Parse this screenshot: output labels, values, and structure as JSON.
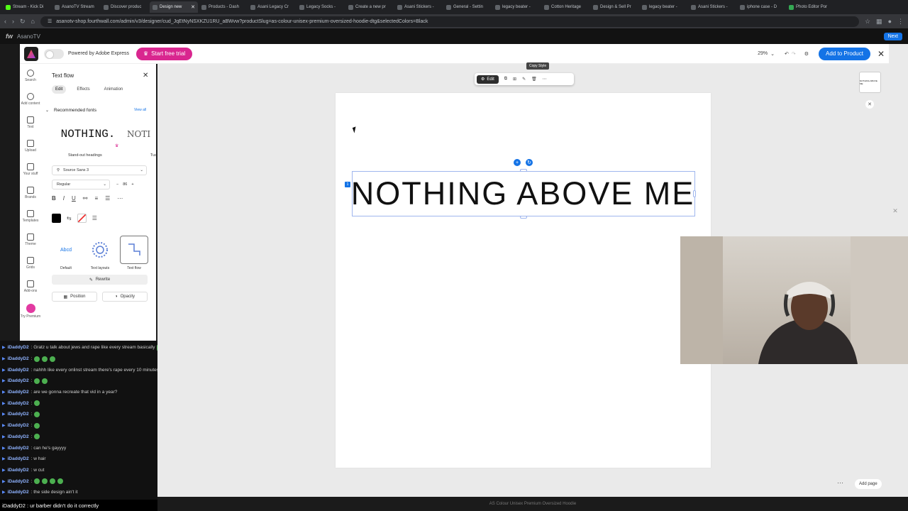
{
  "browser": {
    "tabs": [
      {
        "label": "Stream - Kick Di",
        "fav": "k"
      },
      {
        "label": "AsanoTV Stream",
        "fav": ""
      },
      {
        "label": "Discover produc",
        "fav": ""
      },
      {
        "label": "Design new",
        "fav": "",
        "active": true
      },
      {
        "label": "Products - Dash",
        "fav": ""
      },
      {
        "label": "Asani Legacy Cr",
        "fav": ""
      },
      {
        "label": "Legacy Socks -",
        "fav": ""
      },
      {
        "label": "Create a new pr",
        "fav": ""
      },
      {
        "label": "Asani Stickers -",
        "fav": ""
      },
      {
        "label": "General - Settin",
        "fav": ""
      },
      {
        "label": "legacy beater -",
        "fav": ""
      },
      {
        "label": "Cotton Heritage",
        "fav": ""
      },
      {
        "label": "Design & Sell Pr",
        "fav": ""
      },
      {
        "label": "legacy beater -",
        "fav": ""
      },
      {
        "label": "Asani Stickers -",
        "fav": ""
      },
      {
        "label": "iphone case - D",
        "fav": ""
      },
      {
        "label": "Photo Editor Por",
        "fav": "g"
      }
    ],
    "url": "asanotv-shop.fourthwall.com/admin/v3/designer/cud_JqEtNyNSXKZU1RU_aBWvw?productSlug=as-colour-unisex-premium-oversized-hoodie-dtg&selectedColors=Black",
    "bookmark_label": "AsanoTV",
    "next_label": "Next"
  },
  "appbar": {
    "powered_by": "Powered by Adobe Express",
    "trial_label": "Start free trial",
    "zoom": "29%",
    "add_product_label": "Add to Product"
  },
  "rail": [
    {
      "label": "Search"
    },
    {
      "label": "Add content"
    },
    {
      "label": "Text"
    },
    {
      "label": "Upload"
    },
    {
      "label": "Your stuff"
    },
    {
      "label": "Brands"
    },
    {
      "label": "Templates"
    },
    {
      "label": "Theme"
    },
    {
      "label": "Grids"
    },
    {
      "label": "Add-ons"
    },
    {
      "label": "Try Premium"
    }
  ],
  "panel": {
    "title": "Text flow",
    "tabs": [
      "Edit",
      "Effects",
      "Animation"
    ],
    "recommended_label": "Recommended fonts",
    "view_all": "View all",
    "font_preview_1": "NOTHING.",
    "font_preview_2": "NOTI",
    "font_caption_1": "Stand-out headings",
    "font_caption_2": "Tus",
    "font_family": "Source Sans 3",
    "font_weight": "Regular",
    "font_size": "86",
    "presets": [
      {
        "preview": "Abcd",
        "caption": "Default"
      },
      {
        "preview": "",
        "caption": "Text layouts"
      },
      {
        "preview": "Abc defg",
        "caption": "Text flow"
      }
    ],
    "rewrite_label": "Rewrite",
    "position_label": "Position",
    "opacity_label": "Opacity"
  },
  "canvas": {
    "text": "NOTHING ABOVE ME",
    "layer_number": "1",
    "edit_label": "Edit",
    "copy_style_tooltip": "Copy Style",
    "thumb_text": "NOTHING ABOVE ME",
    "add_page_label": "Add page",
    "footer_label": "AS Colour Unisex Premium Oversized Hoodie"
  },
  "chat": [
    {
      "user": "iDaddyD2",
      "text": ": Gratz u talk about jews and rape like every stream basically",
      "emotes": 1
    },
    {
      "user": "iDaddyD2",
      "text": ":",
      "emotes": 3
    },
    {
      "user": "iDaddyD2",
      "text": ": nahhh like every onlinst stream there's rape every 10 minutes",
      "emotes": 0
    },
    {
      "user": "iDaddyD2",
      "text": ":",
      "emotes": 2
    },
    {
      "user": "iDaddyD2",
      "text": ": are we gonna recreate that vid in a year?",
      "emotes": 0
    },
    {
      "user": "iDaddyD2",
      "text": ":",
      "emotes": 1
    },
    {
      "user": "iDaddyD2",
      "text": ":",
      "emotes": 1
    },
    {
      "user": "iDaddyD2",
      "text": ":",
      "emotes": 1
    },
    {
      "user": "iDaddyD2",
      "text": ":",
      "emotes": 1
    },
    {
      "user": "iDaddyD2",
      "text": ": can he's gayyyy",
      "emotes": 0
    },
    {
      "user": "iDaddyD2",
      "text": ": w hair",
      "emotes": 0
    },
    {
      "user": "iDaddyD2",
      "text": ": w cut",
      "emotes": 0
    },
    {
      "user": "iDaddyD2",
      "text": ":",
      "emotes": 4
    },
    {
      "user": "iDaddyD2",
      "text": ": the side design ain't it",
      "emotes": 0
    }
  ],
  "last_chat": "iDaddyD2 : ur barber didn't do it correctly",
  "colors": {
    "accent": "#1473e6",
    "trial": "#d9268f",
    "text_color": "#111111"
  }
}
